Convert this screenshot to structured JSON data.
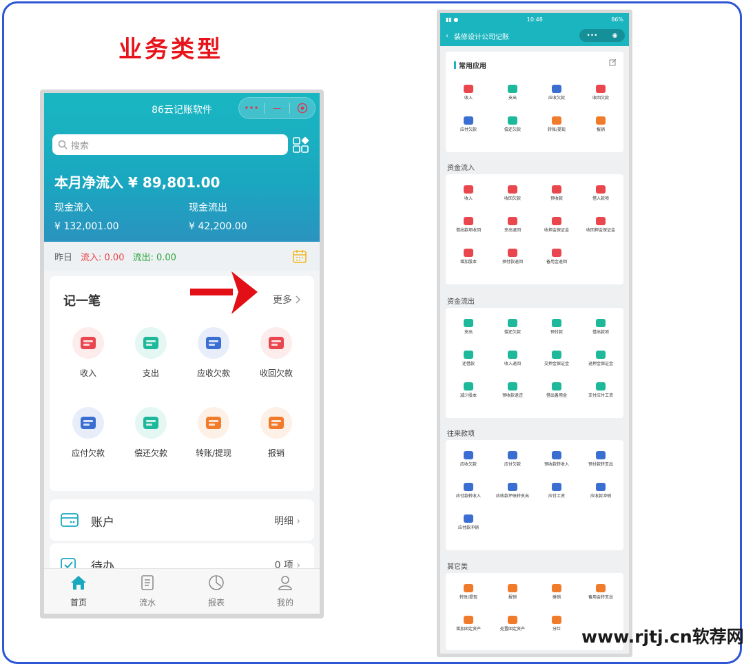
{
  "header": {
    "title": "业务类型"
  },
  "left_phone": {
    "app_name": "86云记账软件",
    "search_placeholder": "搜索",
    "net_inflow_label": "本月净流入 ¥ 89,801.00",
    "cash_in_label": "现金流入",
    "cash_in_value": "¥ 132,001.00",
    "cash_out_label": "现金流出",
    "cash_out_value": "¥ 42,200.00",
    "yesterday_label": "昨日",
    "yesterday_in": "流入: 0.00",
    "yesterday_out": "流出: 0.00",
    "quick_title": "记一笔",
    "more_label": "更多",
    "quick_items": [
      {
        "label": "收入",
        "color": "#e9464d",
        "bg": "#fdecec"
      },
      {
        "label": "支出",
        "color": "#1db99a",
        "bg": "#e4f7f3"
      },
      {
        "label": "应收欠款",
        "color": "#3a6fd1",
        "bg": "#e8eef9"
      },
      {
        "label": "收回欠款",
        "color": "#e9464d",
        "bg": "#fdecec"
      },
      {
        "label": "应付欠款",
        "color": "#3a6fd1",
        "bg": "#e8eef9"
      },
      {
        "label": "偿还欠款",
        "color": "#1db99a",
        "bg": "#e4f7f3"
      },
      {
        "label": "转账/提现",
        "color": "#f07b2a",
        "bg": "#fdf0e6"
      },
      {
        "label": "报销",
        "color": "#f07b2a",
        "bg": "#fdf0e6"
      }
    ],
    "account_label": "账户",
    "account_right": "明细",
    "todo_label": "待办",
    "todo_right": "0 项",
    "tabs": [
      "首页",
      "流水",
      "报表",
      "我的"
    ]
  },
  "right_phone": {
    "status_time": "10:48",
    "status_battery": "86%",
    "nav_title": "装修设计公司记账",
    "common_title": "常用应用",
    "common_items": [
      {
        "label": "收入",
        "color": "#e9464d"
      },
      {
        "label": "支出",
        "color": "#1db99a"
      },
      {
        "label": "应收欠款",
        "color": "#3a6fd1"
      },
      {
        "label": "收回欠款",
        "color": "#e9464d"
      },
      {
        "label": "应付欠款",
        "color": "#3a6fd1"
      },
      {
        "label": "偿还欠款",
        "color": "#1db99a"
      },
      {
        "label": "转账/提现",
        "color": "#f07b2a"
      },
      {
        "label": "报销",
        "color": "#f07b2a"
      }
    ],
    "inflow_title": "资金流入",
    "inflow_items": [
      {
        "label": "收入",
        "color": "#e9464d"
      },
      {
        "label": "收回欠款",
        "color": "#e9464d"
      },
      {
        "label": "预收款",
        "color": "#e9464d"
      },
      {
        "label": "借入款项",
        "color": "#e9464d"
      },
      {
        "label": "借出款项收回",
        "color": "#e9464d"
      },
      {
        "label": "支出退回",
        "color": "#e9464d"
      },
      {
        "label": "收押金保证金",
        "color": "#e9464d"
      },
      {
        "label": "收回押金保证金",
        "color": "#e9464d"
      },
      {
        "label": "增加股本",
        "color": "#e9464d"
      },
      {
        "label": "预付款退回",
        "color": "#e9464d"
      },
      {
        "label": "备用金退回",
        "color": "#e9464d"
      }
    ],
    "outflow_title": "资金流出",
    "outflow_items": [
      {
        "label": "支出",
        "color": "#1db99a"
      },
      {
        "label": "偿还欠款",
        "color": "#1db99a"
      },
      {
        "label": "预付款",
        "color": "#1db99a"
      },
      {
        "label": "借出款项",
        "color": "#1db99a"
      },
      {
        "label": "还借款",
        "color": "#1db99a"
      },
      {
        "label": "收入退回",
        "color": "#1db99a"
      },
      {
        "label": "交押金保证金",
        "color": "#1db99a"
      },
      {
        "label": "退押金保证金",
        "color": "#1db99a"
      },
      {
        "label": "减少股本",
        "color": "#1db99a"
      },
      {
        "label": "预收款退还",
        "color": "#1db99a"
      },
      {
        "label": "借出备用金",
        "color": "#1db99a"
      },
      {
        "label": "支付应付工资",
        "color": "#1db99a"
      }
    ],
    "transfer_title": "往来款项",
    "transfer_items": [
      {
        "label": "应收欠款",
        "color": "#3a6fd1"
      },
      {
        "label": "应付欠款",
        "color": "#3a6fd1"
      },
      {
        "label": "预收款转收入",
        "color": "#3a6fd1"
      },
      {
        "label": "预付款转支出",
        "color": "#3a6fd1"
      },
      {
        "label": "应付款转收入",
        "color": "#3a6fd1"
      },
      {
        "label": "应收款坏账转支出",
        "color": "#3a6fd1"
      },
      {
        "label": "应付工资",
        "color": "#3a6fd1"
      },
      {
        "label": "应收款冲销",
        "color": "#3a6fd1"
      },
      {
        "label": "应付款冲销",
        "color": "#3a6fd1"
      }
    ],
    "other_title": "其它类",
    "other_items": [
      {
        "label": "转账/提现",
        "color": "#f07b2a"
      },
      {
        "label": "报销",
        "color": "#f07b2a"
      },
      {
        "label": "摊销",
        "color": "#f07b2a"
      },
      {
        "label": "备用金转支出",
        "color": "#f07b2a"
      },
      {
        "label": "增加固定资产",
        "color": "#f07b2a"
      },
      {
        "label": "处置固定资产",
        "color": "#f07b2a"
      },
      {
        "label": "分红",
        "color": "#f07b2a"
      }
    ]
  },
  "watermark": "www.rjtj.cn软荐网"
}
